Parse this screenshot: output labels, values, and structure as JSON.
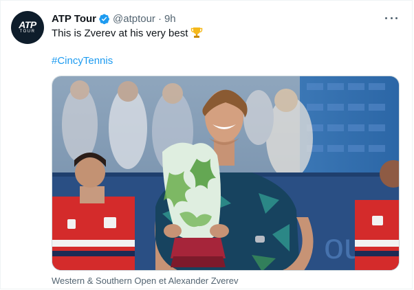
{
  "tweet": {
    "author_name": "ATP Tour",
    "handle": "@atptour",
    "separator": "·",
    "timestamp": "9h",
    "text": "This is Zverev at his very best",
    "hashtag": "#CincyTennis",
    "media_caption": "Western & Southern Open et Alexander Zverev"
  },
  "avatar": {
    "logo_text": "ATP",
    "logo_subtext": "TOUR"
  },
  "media_signage": "out",
  "icons": {
    "verified": "verified-badge-icon",
    "more": "more-options-icon",
    "trophy": "trophy-emoji-icon"
  },
  "colors": {
    "accent": "#1d9bf0",
    "text": "#0f1419",
    "muted": "#536471",
    "avatar_bg": "#0e1d2b"
  }
}
